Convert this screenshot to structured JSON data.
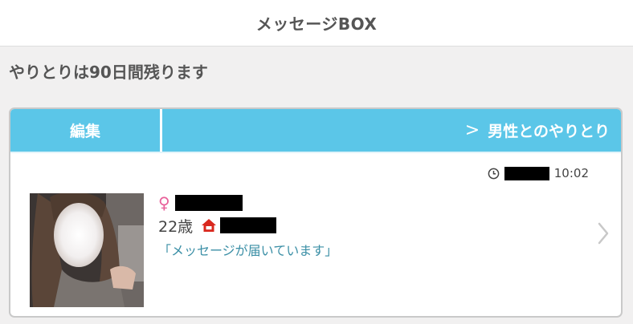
{
  "header": {
    "title": "メッセージBOX"
  },
  "notice": "やりとりは90日間残ります",
  "tabs": {
    "edit_label": "編集",
    "male_label": "男性とのやりとり",
    "male_chevron": ">"
  },
  "message": {
    "time": "10:02",
    "gender_symbol": "♀",
    "age": "22歳",
    "preview": "「メッセージが届いています」"
  },
  "colors": {
    "tab_bar": "#5bc6e8",
    "female": "#e8609a",
    "home": "#d9281e",
    "preview_text": "#3b8fa6"
  },
  "icons": [
    "clock-icon",
    "female-icon",
    "home-icon",
    "chevron-right-icon"
  ]
}
